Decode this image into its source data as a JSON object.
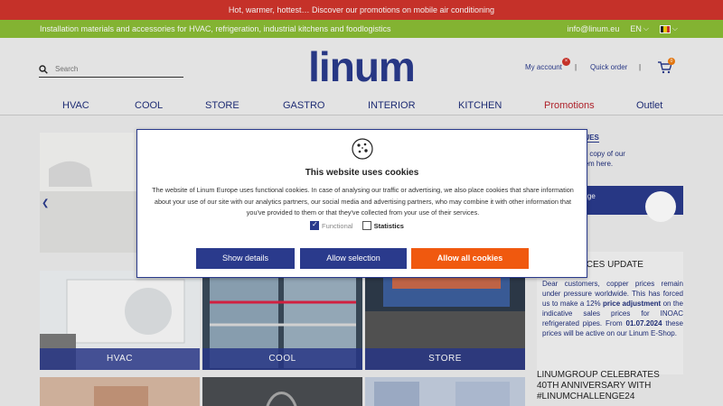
{
  "promo_bar": {
    "text": "Hot, warmer, hottest… Discover our promotions on mobile air conditioning"
  },
  "topbar": {
    "tagline": "Installation materials and accessories for HVAC, refrigeration, industrial kitchens and foodlogistics",
    "email": "info@linum.eu",
    "language": "EN"
  },
  "header": {
    "search_placeholder": "Search",
    "logo_text": "linum",
    "my_account": "My account",
    "account_badge": "×",
    "quick_order": "Quick order",
    "separator": "|",
    "cart_count": "0"
  },
  "nav": {
    "items": [
      {
        "label": "HVAC"
      },
      {
        "label": "COOL"
      },
      {
        "label": "STORE"
      },
      {
        "label": "GASTRO"
      },
      {
        "label": "INTERIOR"
      },
      {
        "label": "KITCHEN"
      },
      {
        "label": "Promotions"
      },
      {
        "label": "Outlet"
      }
    ]
  },
  "catalogues": {
    "title": "OGUES",
    "line1": "a printed copy of our",
    "line2": "order them here.",
    "banner": "page"
  },
  "news": [
    {
      "title": "ICES UPDATE",
      "body_1": "Dear customers, copper prices remain under pressure worldwide. This has forced us to make a 12% ",
      "bold_1": "price adjustment",
      "body_2": " on the indicative sales prices for INOAC refrigerated pipes. From ",
      "bold_2": "01.07.2024",
      "body_3": " these prices will be active on our Linum E-Shop."
    },
    {
      "title": "LINUMGROUP CELEBRATES 40TH ANNIVERSARY WITH #LINUMCHALLENGE24"
    }
  ],
  "tiles": [
    {
      "label": "HVAC"
    },
    {
      "label": "COOL"
    },
    {
      "label": "STORE"
    }
  ],
  "cookie_modal": {
    "title": "This website uses cookies",
    "text": "The website of Linum Europe uses functional cookies. In case of analysing our traffic or advertising, we also place cookies that share information about your use of our site with our analytics partners, our social media and advertising partners, who may combine it with other information that you've provided to them or that they've collected from your use of their services.",
    "functional_label": "Functional",
    "statistics_label": "Statistics",
    "show_details": "Show details",
    "allow_selection": "Allow selection",
    "allow_all": "Allow all cookies"
  },
  "colors": {
    "promo_red": "#d0342c",
    "topbar_green": "#8bbd35",
    "brand_blue": "#2a3a8c",
    "accent_orange": "#f0590f"
  }
}
